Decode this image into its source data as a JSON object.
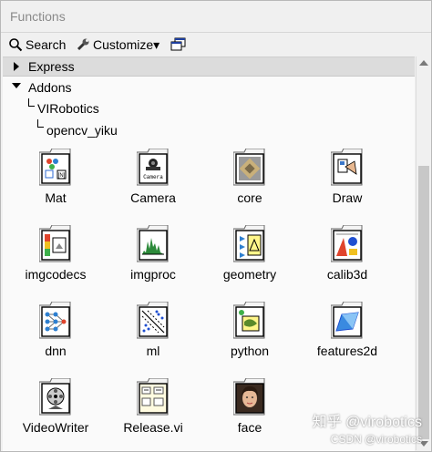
{
  "window": {
    "title": "Functions"
  },
  "toolbar": {
    "search_label": "Search",
    "customize_label": "Customize▾"
  },
  "palette": {
    "express_label": "Express",
    "addons_label": "Addons",
    "virobotics_label": "VIRobotics",
    "opencv_label": "opencv_yiku",
    "items": [
      {
        "label": "Mat",
        "icon": "mat-icon"
      },
      {
        "label": "Camera",
        "icon": "camera-icon"
      },
      {
        "label": "core",
        "icon": "core-chip-icon"
      },
      {
        "label": "Draw",
        "icon": "draw-icon"
      },
      {
        "label": "imgcodecs",
        "icon": "imgcodecs-icon"
      },
      {
        "label": "imgproc",
        "icon": "imgproc-icon"
      },
      {
        "label": "geometry",
        "icon": "geometry-icon"
      },
      {
        "label": "calib3d",
        "icon": "calib3d-icon"
      },
      {
        "label": "dnn",
        "icon": "dnn-icon"
      },
      {
        "label": "ml",
        "icon": "ml-icon"
      },
      {
        "label": "python",
        "icon": "python-icon"
      },
      {
        "label": "features2d",
        "icon": "features2d-icon"
      },
      {
        "label": "VideoWriter",
        "icon": "video-writer-icon"
      },
      {
        "label": "Release.vi",
        "icon": "release-vi-icon"
      },
      {
        "label": "face",
        "icon": "face-icon"
      }
    ],
    "camera_text": "Camera"
  },
  "watermark": {
    "line1": "知乎 @virobotics",
    "line2": "CSDN @virobotics"
  }
}
